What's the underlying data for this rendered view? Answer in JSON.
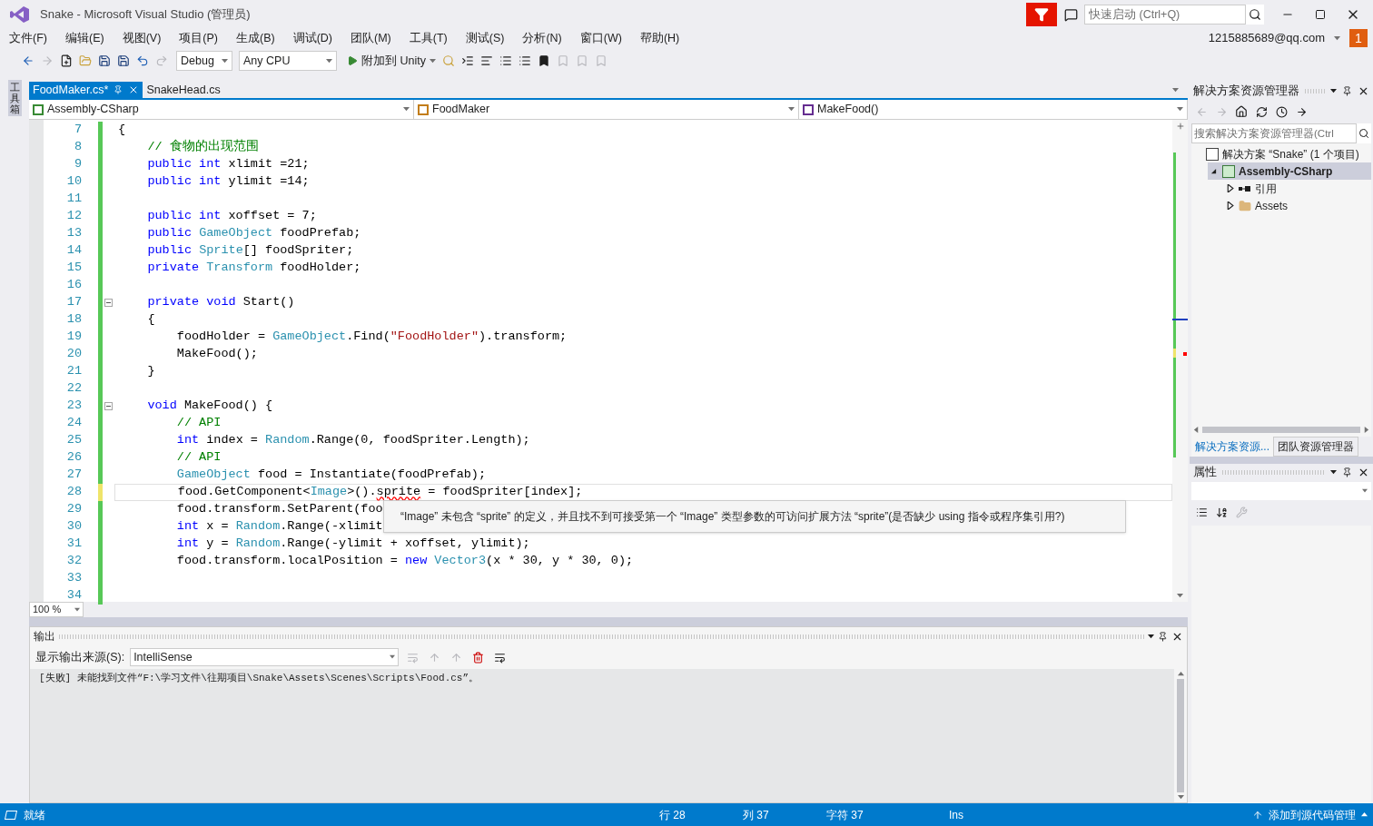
{
  "window": {
    "title": "Snake - Microsoft Visual Studio (管理员)",
    "quick_launch": {
      "placeholder": "快速启动 (Ctrl+Q)"
    },
    "account": "1215885689@qq.com",
    "notifications": "1"
  },
  "menu": [
    "文件(F)",
    "编辑(E)",
    "视图(V)",
    "项目(P)",
    "生成(B)",
    "调试(D)",
    "团队(M)",
    "工具(T)",
    "测试(S)",
    "分析(N)",
    "窗口(W)",
    "帮助(H)"
  ],
  "toolbar": {
    "configuration": "Debug",
    "platform": "Any CPU",
    "run_button": "附加到 Unity"
  },
  "toolbox_strip": "工具箱",
  "tabs": [
    {
      "label": "FoodMaker.cs*",
      "selected": true
    },
    {
      "label": "SnakeHead.cs",
      "selected": false
    }
  ],
  "nav_bar": {
    "project": "Assembly-CSharp",
    "class": "FoodMaker",
    "member": "MakeFood()"
  },
  "code": [
    {
      "no": "7",
      "unsaved": false,
      "current": false,
      "segments": [
        {
          "kind": "plain",
          "text": "{"
        }
      ]
    },
    {
      "no": "8",
      "unsaved": false,
      "current": false,
      "segments": [
        {
          "kind": "comment",
          "text": "    // 食物的出现范围"
        }
      ]
    },
    {
      "no": "9",
      "unsaved": false,
      "current": false,
      "segments": [
        {
          "kind": "keyword",
          "text": "    public int"
        },
        {
          "kind": "plain",
          "text": " xlimit =21;"
        }
      ]
    },
    {
      "no": "10",
      "unsaved": false,
      "current": false,
      "segments": [
        {
          "kind": "keyword",
          "text": "    public int"
        },
        {
          "kind": "plain",
          "text": " ylimit =14;"
        }
      ]
    },
    {
      "no": "11",
      "unsaved": false
    },
    {
      "no": "12",
      "unsaved": false,
      "current": false,
      "segments": [
        {
          "kind": "keyword",
          "text": "    public int"
        },
        {
          "kind": "plain",
          "text": " xoffset = 7;"
        }
      ]
    },
    {
      "no": "13",
      "unsaved": false,
      "current": false,
      "segments": [
        {
          "kind": "keyword",
          "text": "    public "
        },
        {
          "kind": "type",
          "text": "GameObject"
        },
        {
          "kind": "plain",
          "text": " foodPrefab;"
        }
      ]
    },
    {
      "no": "14",
      "unsaved": false,
      "current": false,
      "segments": [
        {
          "kind": "keyword",
          "text": "    public "
        },
        {
          "kind": "type",
          "text": "Sprite"
        },
        {
          "kind": "plain",
          "text": "[] foodSpriter;"
        }
      ]
    },
    {
      "no": "15",
      "unsaved": false,
      "current": false,
      "segments": [
        {
          "kind": "keyword",
          "text": "    private "
        },
        {
          "kind": "type",
          "text": "Transform"
        },
        {
          "kind": "plain",
          "text": " foodHolder;"
        }
      ]
    },
    {
      "no": "16",
      "unsaved": false
    },
    {
      "no": "17",
      "unsaved": false,
      "fold": true,
      "current": false,
      "segments": [
        {
          "kind": "keyword",
          "text": "    private void"
        },
        {
          "kind": "plain",
          "text": " Start()"
        }
      ]
    },
    {
      "no": "18",
      "unsaved": false,
      "current": false,
      "segments": [
        {
          "kind": "plain",
          "text": "    {"
        }
      ]
    },
    {
      "no": "19",
      "unsaved": false,
      "current": false,
      "segments": [
        {
          "kind": "plain",
          "text": "        foodHolder = "
        },
        {
          "kind": "type",
          "text": "GameObject"
        },
        {
          "kind": "plain",
          "text": ".Find("
        },
        {
          "kind": "string",
          "text": "\"FoodHolder\""
        },
        {
          "kind": "plain",
          "text": ").transform;"
        }
      ]
    },
    {
      "no": "20",
      "unsaved": false,
      "current": false,
      "segments": [
        {
          "kind": "plain",
          "text": "        MakeFood();"
        }
      ]
    },
    {
      "no": "21",
      "unsaved": false,
      "current": false,
      "segments": [
        {
          "kind": "plain",
          "text": "    }"
        }
      ]
    },
    {
      "no": "22",
      "unsaved": false
    },
    {
      "no": "23",
      "unsaved": false,
      "fold": true,
      "current": false,
      "segments": [
        {
          "kind": "keyword",
          "text": "    void"
        },
        {
          "kind": "plain",
          "text": " MakeFood() {"
        }
      ]
    },
    {
      "no": "24",
      "unsaved": false,
      "current": false,
      "segments": [
        {
          "kind": "comment",
          "text": "        // API"
        }
      ]
    },
    {
      "no": "25",
      "unsaved": false,
      "current": false,
      "segments": [
        {
          "kind": "keyword",
          "text": "        int"
        },
        {
          "kind": "plain",
          "text": " index = "
        },
        {
          "kind": "type",
          "text": "Random"
        },
        {
          "kind": "plain",
          "text": ".Range(0, foodSpriter.Length);"
        }
      ]
    },
    {
      "no": "26",
      "unsaved": false,
      "current": false,
      "segments": [
        {
          "kind": "comment",
          "text": "        // API"
        }
      ]
    },
    {
      "no": "27",
      "unsaved": false,
      "current": false,
      "segments": [
        {
          "kind": "type",
          "text": "        GameObject"
        },
        {
          "kind": "plain",
          "text": " food = Instantiate(foodPrefab);"
        }
      ]
    },
    {
      "no": "28",
      "unsaved": true,
      "current": true,
      "segments": [
        {
          "kind": "plain",
          "text": "        food.GetComponent<"
        },
        {
          "kind": "type",
          "text": "Image"
        },
        {
          "kind": "plain",
          "text": ">()."
        },
        {
          "kind": "error",
          "text": "sprite"
        },
        {
          "kind": "plain",
          "text": " = foodSpriter[index];"
        }
      ]
    },
    {
      "no": "29",
      "unsaved": false,
      "current": false,
      "segments": [
        {
          "kind": "plain",
          "text": "        food.transform.SetParent(foo"
        }
      ]
    },
    {
      "no": "30",
      "unsaved": false,
      "current": false,
      "segments": [
        {
          "kind": "keyword",
          "text": "        int"
        },
        {
          "kind": "plain",
          "text": " x = "
        },
        {
          "kind": "type",
          "text": "Random"
        },
        {
          "kind": "plain",
          "text": ".Range(-xlimit"
        }
      ]
    },
    {
      "no": "31",
      "unsaved": false,
      "current": false,
      "segments": [
        {
          "kind": "keyword",
          "text": "        int"
        },
        {
          "kind": "plain",
          "text": " y = "
        },
        {
          "kind": "type",
          "text": "Random"
        },
        {
          "kind": "plain",
          "text": ".Range(-ylimit + xoffset, ylimit);"
        }
      ]
    },
    {
      "no": "32",
      "unsaved": false,
      "current": false,
      "segments": [
        {
          "kind": "plain",
          "text": "        food.transform.localPosition = "
        },
        {
          "kind": "keyword",
          "text": "new "
        },
        {
          "kind": "type",
          "text": "Vector3"
        },
        {
          "kind": "plain",
          "text": "(x * 30, y * 30, 0);"
        }
      ]
    },
    {
      "no": "33",
      "unsaved": false
    },
    {
      "no": "34",
      "unsaved": false
    }
  ],
  "error_tooltip": "“Image” 未包含 “sprite” 的定义，并且找不到可接受第一个 “Image” 类型参数的可访问扩展方法 “sprite”(是否缺少 using 指令或程序集引用?)",
  "zoom": "100 %",
  "output": {
    "title": "输出",
    "source_label": "显示输出来源(S):",
    "source": "IntelliSense",
    "lines": [
      "[失败] 未能找到文件“F:\\学习文件\\往期项目\\Snake\\Assets\\Scenes\\Scripts\\Food.cs”。"
    ]
  },
  "solution_explorer": {
    "title": "解决方案资源管理器",
    "search": {
      "placeholder": "搜索解决方案资源管理器(Ctrl"
    },
    "tree": [
      {
        "label": "解决方案 “Snake” (1 个项目)",
        "kind": "solution",
        "selected": false,
        "children": [
          {
            "label": "Assembly-CSharp",
            "kind": "project",
            "expanded": true,
            "selected": true,
            "children": [
              {
                "label": "引用",
                "kind": "references",
                "expanded": false,
                "selected": false
              },
              {
                "label": "Assets",
                "kind": "folder",
                "expanded": false,
                "selected": false
              }
            ]
          }
        ]
      }
    ],
    "tabs": [
      {
        "label": "解决方案资源...",
        "selected": true
      },
      {
        "label": "团队资源管理器",
        "selected": false
      }
    ]
  },
  "properties": {
    "title": "属性"
  },
  "status_bar": {
    "state": "就绪",
    "line": "行 28",
    "column": "列 37",
    "char": "字符 37",
    "mode": "Ins",
    "source_control": "添加到源代码管理"
  }
}
